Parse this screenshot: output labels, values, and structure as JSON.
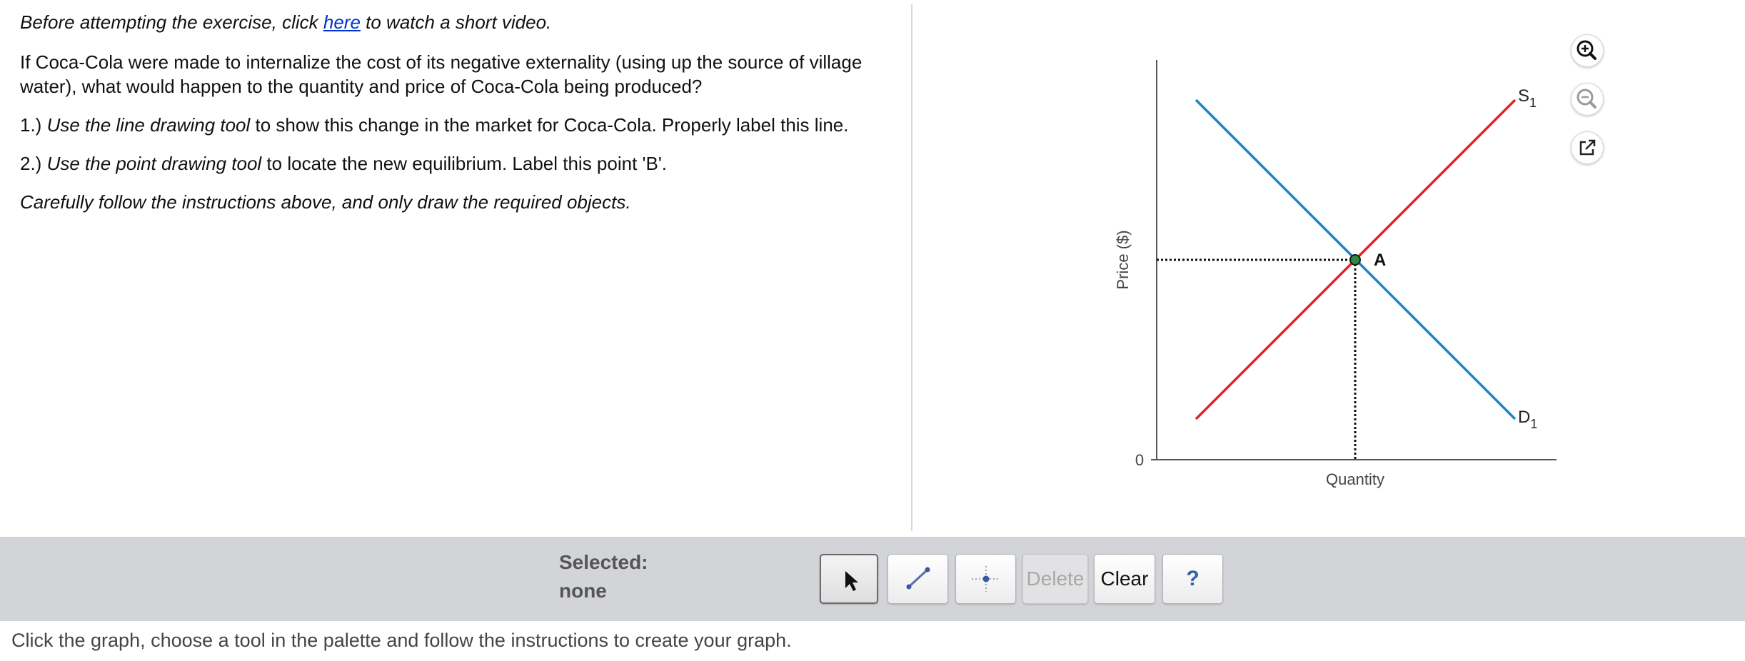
{
  "instructions": {
    "intro_before": "Before attempting the exercise, click ",
    "intro_link": "here",
    "intro_after": " to watch a short video.",
    "question": "If Coca-Cola were made to internalize the cost of its negative externality (using up the source of village water), what would happen to the quantity and price of Coca-Cola being produced?",
    "step1_prefix": "1.) ",
    "step1_emph": "Use the line drawing tool",
    "step1_rest": " to show this change in the market for Coca-Cola. Properly label this line.",
    "step2_prefix": "2.) ",
    "step2_emph": "Use the point drawing tool",
    "step2_rest": " to locate the new equilibrium. Label this point 'B'.",
    "careful": "Carefully follow the instructions above, and only draw the required objects."
  },
  "graph": {
    "y_axis_label": "Price ($)",
    "x_axis_label": "Quantity",
    "origin_label": "0",
    "supply_label": "S",
    "supply_subscript": "1",
    "demand_label": "D",
    "demand_subscript": "1",
    "equilibrium_label": "A",
    "colors": {
      "supply": "#e8202a",
      "demand": "#1d84c6",
      "point": "#2e8b3a"
    }
  },
  "side_icons": [
    "zoom-in-icon",
    "zoom-out-icon",
    "pop-out-icon"
  ],
  "toolbar": {
    "selected_label": "Selected:",
    "selected_value": "none",
    "delete_label": "Delete",
    "clear_label": "Clear",
    "help_label": "?"
  },
  "status": {
    "text": "Click the graph, choose a tool in the palette and follow the instructions to create your graph."
  }
}
